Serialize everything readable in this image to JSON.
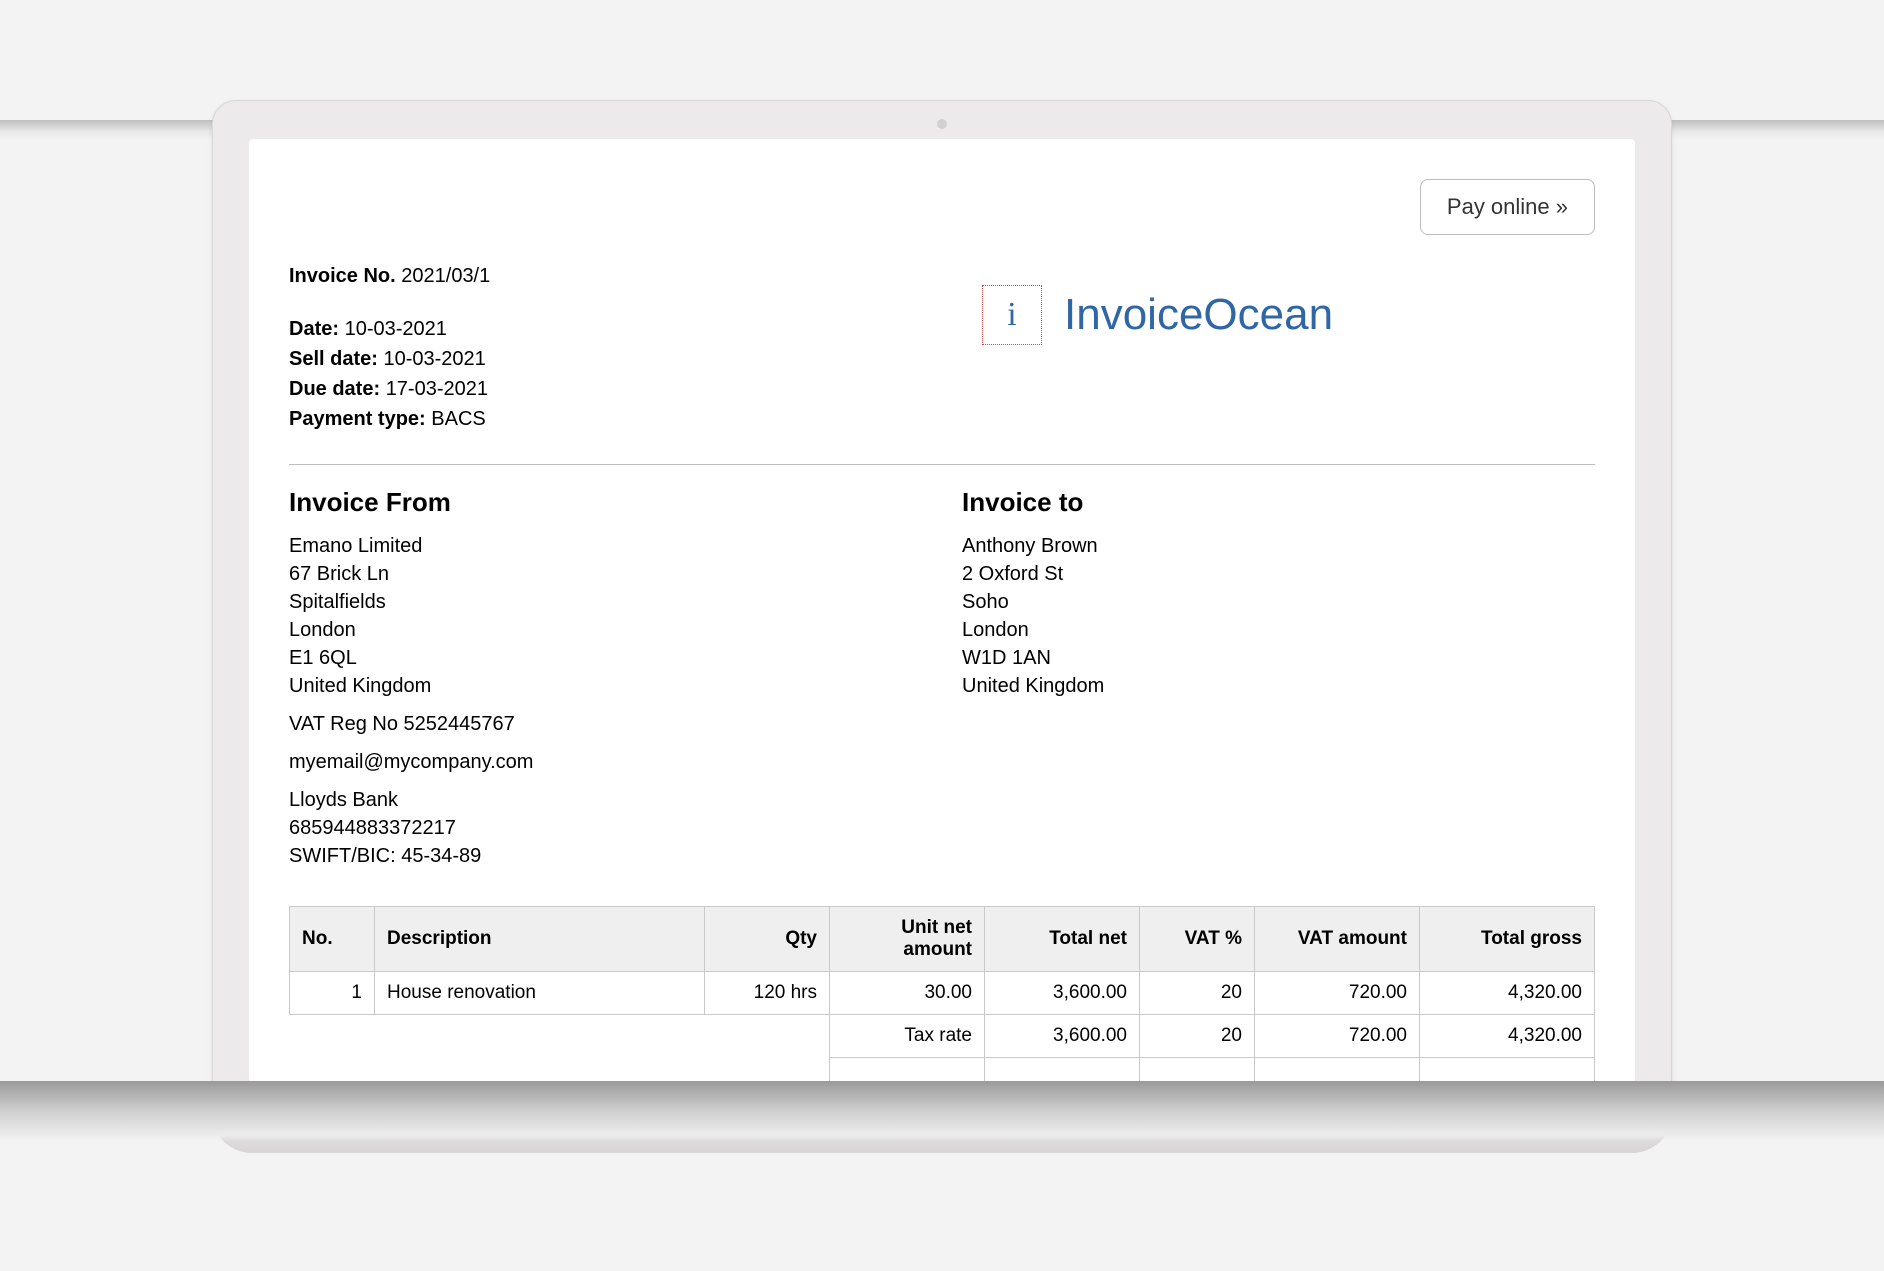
{
  "buttons": {
    "pay_online": "Pay online »"
  },
  "invoice": {
    "number_label": "Invoice No.",
    "number": "2021/03/1",
    "date_label": "Date:",
    "date": "10-03-2021",
    "sell_date_label": "Sell date:",
    "sell_date": "10-03-2021",
    "due_date_label": "Due date:",
    "due_date": "17-03-2021",
    "payment_type_label": "Payment type:",
    "payment_type": "BACS"
  },
  "brand": {
    "logo_glyph": "i",
    "name": "InvoiceOcean",
    "color": "#2f66a5"
  },
  "from": {
    "heading": "Invoice From",
    "name": "Emano Limited",
    "addr1": "67 Brick Ln",
    "addr2": "Spitalfields",
    "city": "London",
    "postcode": "E1 6QL",
    "country": "United Kingdom",
    "vat": "VAT Reg No 5252445767",
    "email": "myemail@mycompany.com",
    "bank_name": "Lloyds Bank",
    "bank_account": "685944883372217",
    "swift": "SWIFT/BIC: 45-34-89"
  },
  "to": {
    "heading": "Invoice to",
    "name": "Anthony Brown",
    "addr1": "2 Oxford St",
    "addr2": "Soho",
    "city": "London",
    "postcode": "W1D 1AN",
    "country": "United Kingdom"
  },
  "table": {
    "headers": {
      "no": "No.",
      "desc": "Description",
      "qty": "Qty",
      "unit_net": "Unit net amount",
      "total_net": "Total net",
      "vat_pct": "VAT %",
      "vat_amount": "VAT amount",
      "total_gross": "Total gross"
    },
    "rows": [
      {
        "no": "1",
        "desc": "House renovation",
        "qty": "120 hrs",
        "unit_net": "30.00",
        "total_net": "3,600.00",
        "vat_pct": "20",
        "vat_amount": "720.00",
        "total_gross": "4,320.00"
      }
    ],
    "tax_summary_label": "Tax rate",
    "tax_summary": {
      "total_net": "3,600.00",
      "vat_pct": "20",
      "vat_amount": "720.00",
      "total_gross": "4,320.00"
    }
  }
}
